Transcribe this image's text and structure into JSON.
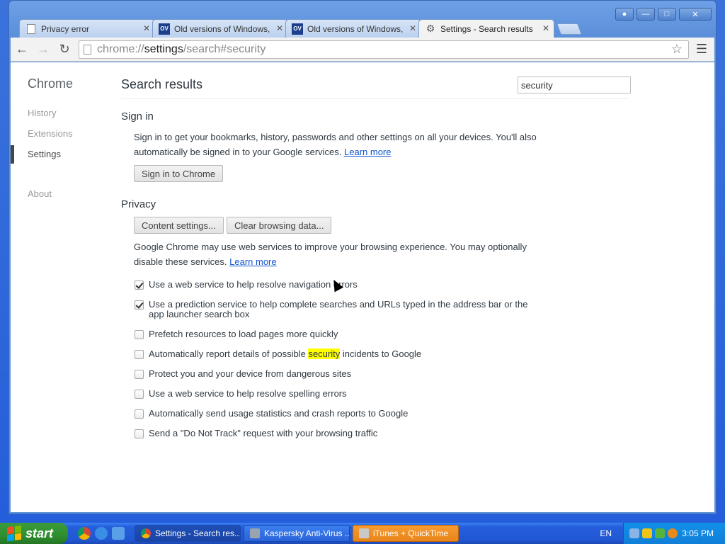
{
  "browser": {
    "tabs": [
      {
        "title": "Privacy error",
        "icon": "page-icon",
        "active": false
      },
      {
        "title": "Old versions of Windows, Ma",
        "icon": "ov-icon",
        "active": false
      },
      {
        "title": "Old versions of Windows, Ma",
        "icon": "ov-icon",
        "active": false
      },
      {
        "title": "Settings - Search results",
        "icon": "gear-icon",
        "active": true
      }
    ],
    "url_scheme": "chrome://",
    "url_host": "settings",
    "url_path": "/search#security"
  },
  "sidebar": {
    "brand": "Chrome",
    "items": [
      {
        "label": "History"
      },
      {
        "label": "Extensions"
      },
      {
        "label": "Settings",
        "selected": true
      },
      {
        "label": "About"
      }
    ]
  },
  "main": {
    "title": "Search results",
    "search_value": "security",
    "signin": {
      "heading": "Sign in",
      "text": "Sign in to get your bookmarks, history, passwords and other settings on all your devices. You'll also automatically be signed in to your Google services.",
      "link": "Learn more",
      "button": "Sign in to Chrome"
    },
    "privacy": {
      "heading": "Privacy",
      "content_settings_button": "Content settings...",
      "clear_data_button": "Clear browsing data...",
      "text": "Google Chrome may use web services to improve your browsing experience. You may optionally disable these services.",
      "link": "Learn more",
      "options": [
        {
          "label": "Use a web service to help resolve navigation errors",
          "checked": true
        },
        {
          "label": "Use a prediction service to help complete searches and URLs typed in the address bar or the app launcher search box",
          "checked": true
        },
        {
          "label": "Prefetch resources to load pages more quickly",
          "checked": false
        },
        {
          "label_before": "Automatically report details of possible ",
          "label_highlight": "security",
          "label_after": " incidents to Google",
          "checked": false
        },
        {
          "label": "Protect you and your device from dangerous sites",
          "checked": false
        },
        {
          "label": "Use a web service to help resolve spelling errors",
          "checked": false
        },
        {
          "label": "Automatically send usage statistics and crash reports to Google",
          "checked": false
        },
        {
          "label": "Send a \"Do Not Track\" request with your browsing traffic",
          "checked": false
        }
      ]
    }
  },
  "taskbar": {
    "start_label": "start",
    "tasks": [
      {
        "label": "Settings - Search res...",
        "icon": "chrome-icon"
      },
      {
        "label": "Kaspersky Anti-Virus ...",
        "icon": "kaspersky-icon"
      },
      {
        "label": "iTunes + QuickTime",
        "icon": "installer-icon"
      }
    ],
    "language": "EN",
    "clock": "3:05 PM"
  },
  "colors": {
    "link": "#1155cc",
    "highlight": "#ffff00",
    "taskbar_blue": "#245edb",
    "start_green": "#2f8f2f"
  }
}
